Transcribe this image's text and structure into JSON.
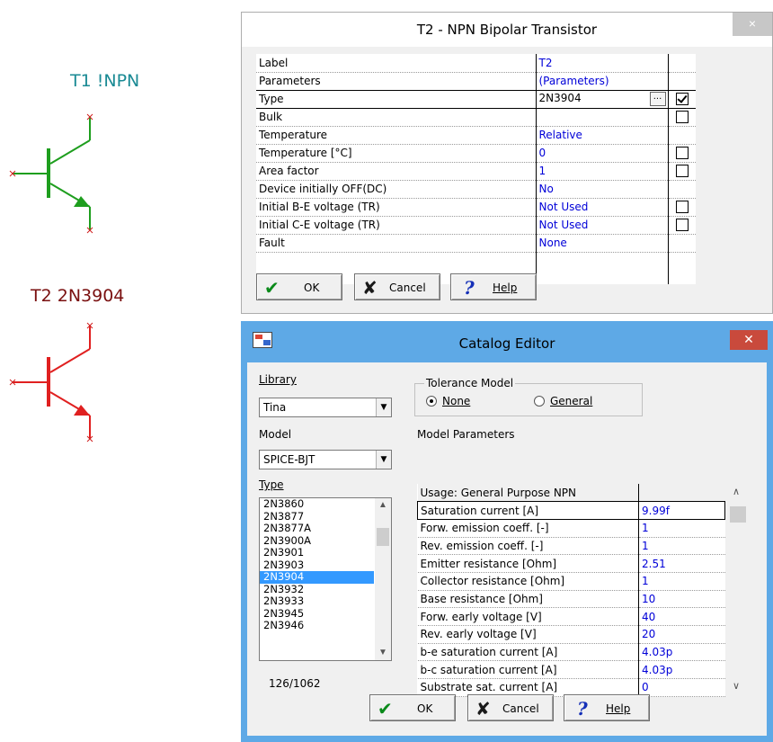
{
  "schematic": {
    "t1_label": "T1 !NPN",
    "t2_label": "T2 2N3904",
    "t1_color": "#1a8a94",
    "t1_wire": "#1e9e1e",
    "t2_color": "#7a1010",
    "t2_wire": "#e02020"
  },
  "dialog1": {
    "title": "T2 - NPN Bipolar Transistor",
    "close_glyph": "×",
    "rows": [
      {
        "label": "Label",
        "value": "T2"
      },
      {
        "label": "Parameters",
        "value": "(Parameters)"
      },
      {
        "label": "Type",
        "value": "2N3904",
        "dots": "...",
        "checked": true
      },
      {
        "label": "Bulk",
        "value": ""
      },
      {
        "label": "Temperature",
        "value": "Relative"
      },
      {
        "label": "Temperature [°C]",
        "value": "0"
      },
      {
        "label": "Area factor",
        "value": "1"
      },
      {
        "label": "Device initially OFF(DC)",
        "value": "No"
      },
      {
        "label": "Initial B-E voltage (TR)",
        "value": "Not Used"
      },
      {
        "label": "Initial C-E voltage (TR)",
        "value": "Not Used"
      },
      {
        "label": "Fault",
        "value": "None"
      }
    ],
    "ok_label": "OK",
    "cancel_label": "Cancel",
    "help_label": "Help"
  },
  "dialog2": {
    "title": "Catalog Editor",
    "close_glyph": "✕",
    "library_label": "Library",
    "library_value": "Tina",
    "model_label": "Model",
    "model_value": "SPICE-BJT",
    "type_label": "Type",
    "types": [
      "2N3860",
      "2N3877",
      "2N3877A",
      "2N3900A",
      "2N3901",
      "2N3903",
      "2N3904",
      "2N3932",
      "2N3933",
      "2N3945",
      "2N3946"
    ],
    "selected_type": "2N3904",
    "count": "126/1062",
    "tolerance_legend": "Tolerance Model",
    "tol_none": "None",
    "tol_general": "General",
    "model_params_label": "Model Parameters",
    "usage": "Usage: General Purpose NPN",
    "params": [
      {
        "name": "Saturation current    [A]",
        "value": "9.99f"
      },
      {
        "name": "Forw. emission coeff.  [-]",
        "value": "1"
      },
      {
        "name": "Rev.  emission coeff.  [-]",
        "value": "1"
      },
      {
        "name": "Emitter resistance  [Ohm]",
        "value": "2.51"
      },
      {
        "name": "Collector resistance [Ohm]",
        "value": "1"
      },
      {
        "name": "Base resistance      [Ohm]",
        "value": "10"
      },
      {
        "name": "Forw.  early voltage    [V]",
        "value": "40"
      },
      {
        "name": "Rev.  early voltage    [V]",
        "value": "20"
      },
      {
        "name": "b-e saturation current [A]",
        "value": "4.03p"
      },
      {
        "name": "b-c saturation current [A]",
        "value": "4.03p"
      },
      {
        "name": "Substrate sat. current [A]",
        "value": "0"
      }
    ],
    "ok_label": "OK",
    "cancel_label": "Cancel",
    "help_label": "Help"
  }
}
